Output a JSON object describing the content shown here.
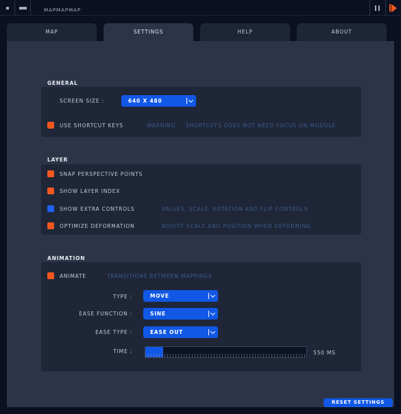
{
  "app": {
    "title": "MAPMAPMAP"
  },
  "titlebar": {
    "icons": [
      "square-icon",
      "minimize-icon",
      "pause-icon",
      "play-icon"
    ]
  },
  "tabs": [
    {
      "label": "MAP",
      "active": false
    },
    {
      "label": "SETTINGS",
      "active": true
    },
    {
      "label": "HELP",
      "active": false
    },
    {
      "label": "ABOUT",
      "active": false
    }
  ],
  "general": {
    "title": "GENERAL",
    "screen_size": {
      "label": "SCREEN SIZE :",
      "value": "640 X 480"
    },
    "shortcut": {
      "label": "USE SHORTCUT KEYS",
      "hint_warning": "WARNING",
      "hint_text": "SHORTCUTS DOES NOT NEED FOCUS ON MODULE",
      "checked": true
    }
  },
  "layer": {
    "title": "LAYER",
    "options": [
      {
        "label": "SNAP PERSPECTIVE POINTS",
        "hint": "",
        "color": "#f2581e"
      },
      {
        "label": "SHOW LAYER INDEX",
        "hint": "",
        "color": "#f2581e"
      },
      {
        "label": "SHOW EXTRA CONTROLS",
        "hint": "VALUES, SCALE, ROTATION AND FLIP  CONTROLS",
        "color": "#1d62f0"
      },
      {
        "label": "OPTIMIZE DEFORMATION",
        "hint": "ADJUST SCALE AND POSITION WHEN DEFORMING",
        "color": "#f2581e"
      }
    ]
  },
  "animation": {
    "title": "ANIMATION",
    "animate": {
      "label": "ANIMATE",
      "hint": "TRANSITIONS BETWEEN MAPPINGS",
      "checked": true
    },
    "type": {
      "label": "TYPE :",
      "value": "MOVE"
    },
    "ease_function": {
      "label": "EASE FUNCTION :",
      "value": "SINE"
    },
    "ease_type": {
      "label": "EASE TYPE :",
      "value": "EASE OUT"
    },
    "time": {
      "label": "TIME :",
      "value_ms": 550,
      "value_text": "550  MS",
      "fraction": 0.11
    }
  },
  "footer": {
    "reset_label": "RESET SETTINGS"
  },
  "colors": {
    "accent_blue": "#1258e6",
    "accent_orange": "#f2581e",
    "panel": "#1e2638",
    "background": "#2c3448"
  }
}
